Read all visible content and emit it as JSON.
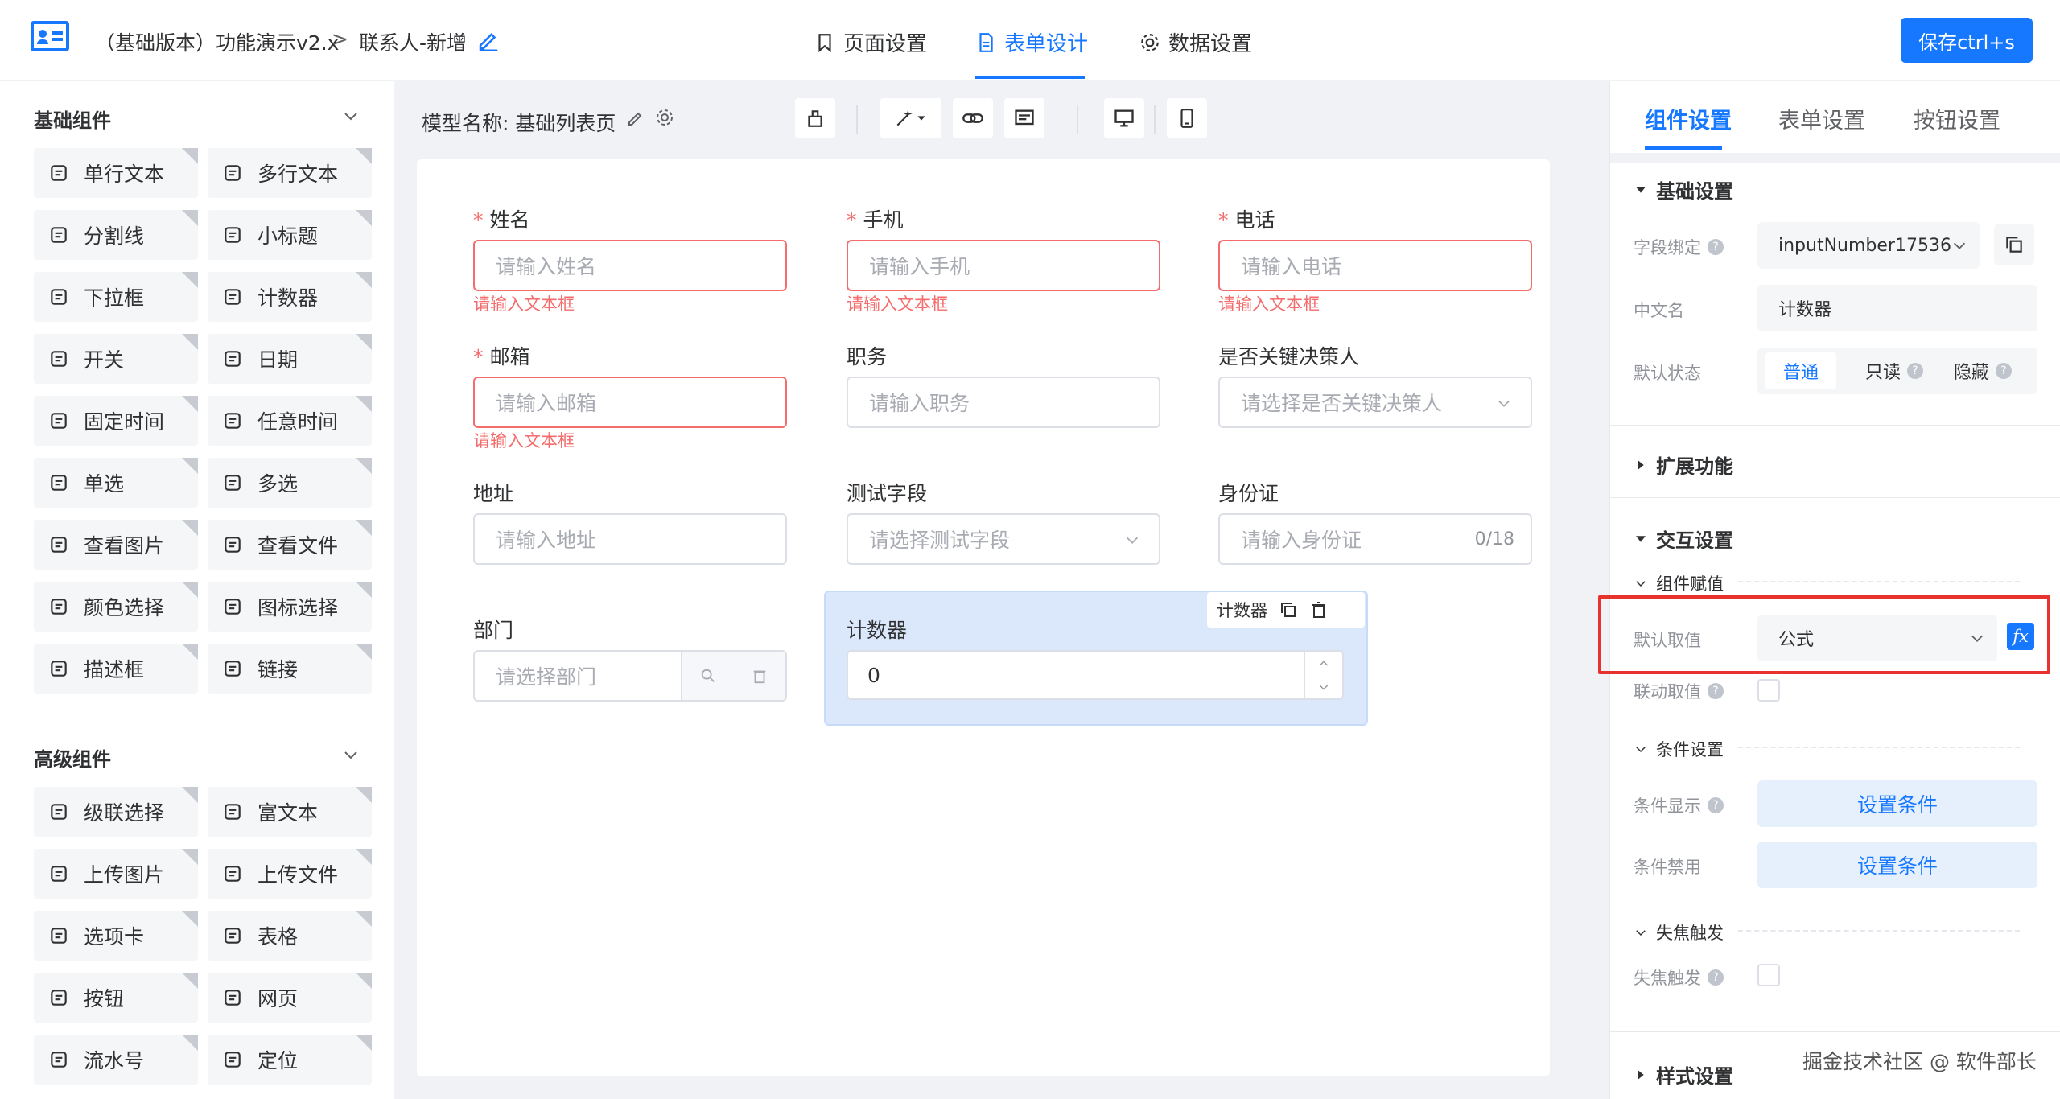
{
  "header": {
    "breadcrumb_app": "（基础版本）功能演示v2.x",
    "breadcrumb_sep": ">",
    "breadcrumb_page": "联系人-新增",
    "tabs": [
      {
        "label": "页面设置",
        "icon": "bookmark-icon"
      },
      {
        "label": "表单设计",
        "icon": "document-icon",
        "active": true
      },
      {
        "label": "数据设置",
        "icon": "gear-icon"
      }
    ],
    "save_label": "保存ctrl+s",
    "accent": "#1677ff"
  },
  "left": {
    "basic_title": "基础组件",
    "basic_items": [
      {
        "label": "单行文本",
        "icon": "text-box-icon"
      },
      {
        "label": "多行文本",
        "icon": "multiline-text-icon"
      },
      {
        "label": "分割线",
        "icon": "divider-icon"
      },
      {
        "label": "小标题",
        "icon": "heading-icon"
      },
      {
        "label": "下拉框",
        "icon": "dropdown-icon"
      },
      {
        "label": "计数器",
        "icon": "counter-icon"
      },
      {
        "label": "开关",
        "icon": "toggle-icon"
      },
      {
        "label": "日期",
        "icon": "calendar-icon"
      },
      {
        "label": "固定时间",
        "icon": "stopwatch-icon"
      },
      {
        "label": "任意时间",
        "icon": "clock-icon"
      },
      {
        "label": "单选",
        "icon": "radio-icon"
      },
      {
        "label": "多选",
        "icon": "checkbox-icon"
      },
      {
        "label": "查看图片",
        "icon": "image-icon"
      },
      {
        "label": "查看文件",
        "icon": "file-icon"
      },
      {
        "label": "颜色选择",
        "icon": "palette-icon"
      },
      {
        "label": "图标选择",
        "icon": "icon-select-icon"
      },
      {
        "label": "描述框",
        "icon": "description-icon"
      },
      {
        "label": "链接",
        "icon": "link-icon"
      }
    ],
    "advanced_title": "高级组件",
    "advanced_items": [
      {
        "label": "级联选择",
        "icon": "cascade-icon"
      },
      {
        "label": "富文本",
        "icon": "rich-text-icon"
      },
      {
        "label": "上传图片",
        "icon": "upload-image-icon"
      },
      {
        "label": "上传文件",
        "icon": "upload-file-icon"
      },
      {
        "label": "选项卡",
        "icon": "tabs-icon"
      },
      {
        "label": "表格",
        "icon": "table-icon"
      },
      {
        "label": "按钮",
        "icon": "button-icon"
      },
      {
        "label": "网页",
        "icon": "webpage-icon"
      },
      {
        "label": "流水号",
        "icon": "serial-number-icon"
      },
      {
        "label": "定位",
        "icon": "location-pin-icon"
      }
    ]
  },
  "center": {
    "model_label": "模型名称:  基础列表页",
    "form": {
      "name": {
        "label": "姓名",
        "required": true,
        "placeholder": "请输入姓名",
        "error": "请输入文本框"
      },
      "mobile": {
        "label": "手机",
        "required": true,
        "placeholder": "请输入手机",
        "error": "请输入文本框"
      },
      "phone": {
        "label": "电话",
        "required": true,
        "placeholder": "请输入电话",
        "error": "请输入文本框"
      },
      "email": {
        "label": "邮箱",
        "required": true,
        "placeholder": "请输入邮箱",
        "error": "请输入文本框"
      },
      "position": {
        "label": "职务",
        "placeholder": "请输入职务"
      },
      "key_decision": {
        "label": "是否关键决策人",
        "placeholder": "请选择是否关键决策人"
      },
      "address": {
        "label": "地址",
        "placeholder": "请输入地址"
      },
      "test_field": {
        "label": "测试字段",
        "placeholder": "请选择测试字段"
      },
      "id_card": {
        "label": "身份证",
        "placeholder": "请输入身份证",
        "count": "0/18"
      },
      "department": {
        "label": "部门",
        "placeholder": "请选择部门"
      },
      "counter": {
        "label": "计数器",
        "value": "0",
        "toolbar_label": "计数器"
      }
    }
  },
  "right": {
    "tabs": [
      "组件设置",
      "表单设置",
      "按钮设置"
    ],
    "basic_section": "基础设置",
    "field_binding_label": "字段绑定",
    "field_binding_value": "inputNumber17536",
    "cn_name_label": "中文名",
    "cn_name_value": "计数器",
    "default_state_label": "默认状态",
    "state_options": [
      "普通",
      "只读",
      "隐藏"
    ],
    "ext_section": "扩展功能",
    "interaction_section": "交互设置",
    "assign_sub": "组件赋值",
    "default_value_label": "默认取值",
    "default_value": "公式",
    "fx_label": "fx",
    "linked_value_label": "联动取值",
    "condition_sub": "条件设置",
    "cond_show_label": "条件显示",
    "cond_disable_label": "条件禁用",
    "set_condition": "设置条件",
    "blur_sub": "失焦触发",
    "blur_trigger_label": "失焦触发",
    "style_section": "样式设置"
  },
  "watermark": "掘金技术社区 @ 软件部长"
}
